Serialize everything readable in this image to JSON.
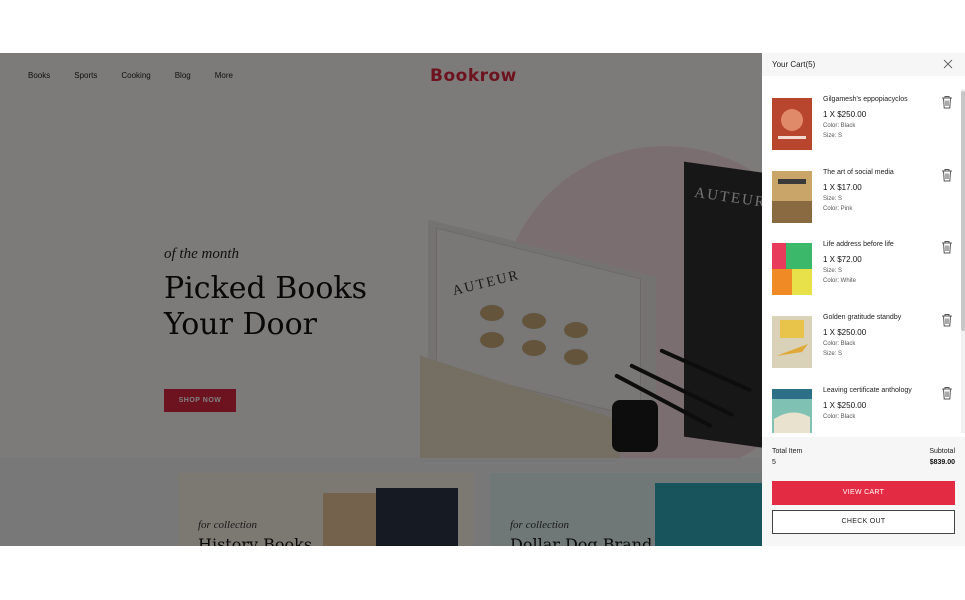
{
  "site": {
    "nav": [
      "Books",
      "Sports",
      "Cooking",
      "Blog",
      "More"
    ],
    "logo": "Bookrow",
    "hero": {
      "kicker": "of the month",
      "headline_line1": "Picked Books",
      "headline_line2": "Your Door",
      "cta": "SHOP NOW",
      "book_front_title": "AUTEUR",
      "book_back_title": "AUTEUR"
    },
    "collections": [
      {
        "kicker": "for collection",
        "title": "History Books"
      },
      {
        "kicker": "for collection",
        "title": "Dollar Dog Brand"
      }
    ]
  },
  "cart": {
    "title": "Your Cart(5)",
    "items": [
      {
        "name": "Gilgamesh's eppopiacyclos",
        "price": "1 X $250.00",
        "meta": [
          "Color: Black",
          "Size:   S"
        ],
        "thumb_color": "#b8452e"
      },
      {
        "name": "The art of social media",
        "price": "1 X $17.00",
        "meta": [
          "Size:   S",
          "Color: Pink"
        ],
        "thumb_color": "#c9a56a"
      },
      {
        "name": "Life address before life",
        "price": "1 X $72.00",
        "meta": [
          "Size:   S",
          "Color: White"
        ],
        "thumb_color": "#f2c230"
      },
      {
        "name": "Golden gratitude standby",
        "price": "1 X $250.00",
        "meta": [
          "Color: Black",
          "Size:   S"
        ],
        "thumb_color": "#d9d2b8"
      },
      {
        "name": "Leaving certificate anthology",
        "price": "1 X $250.00",
        "meta": [
          "Color: Black"
        ],
        "thumb_color": "#7fc1b2"
      }
    ],
    "footer": {
      "total_item_label": "Total Item",
      "total_item_value": "5",
      "subtotal_label": "Subtotal",
      "subtotal_value": "$839.00",
      "view_cart": "VIEW CART",
      "checkout": "CHECK OUT"
    }
  },
  "colors": {
    "accent": "#e32b43",
    "brand": "#d8263f"
  }
}
